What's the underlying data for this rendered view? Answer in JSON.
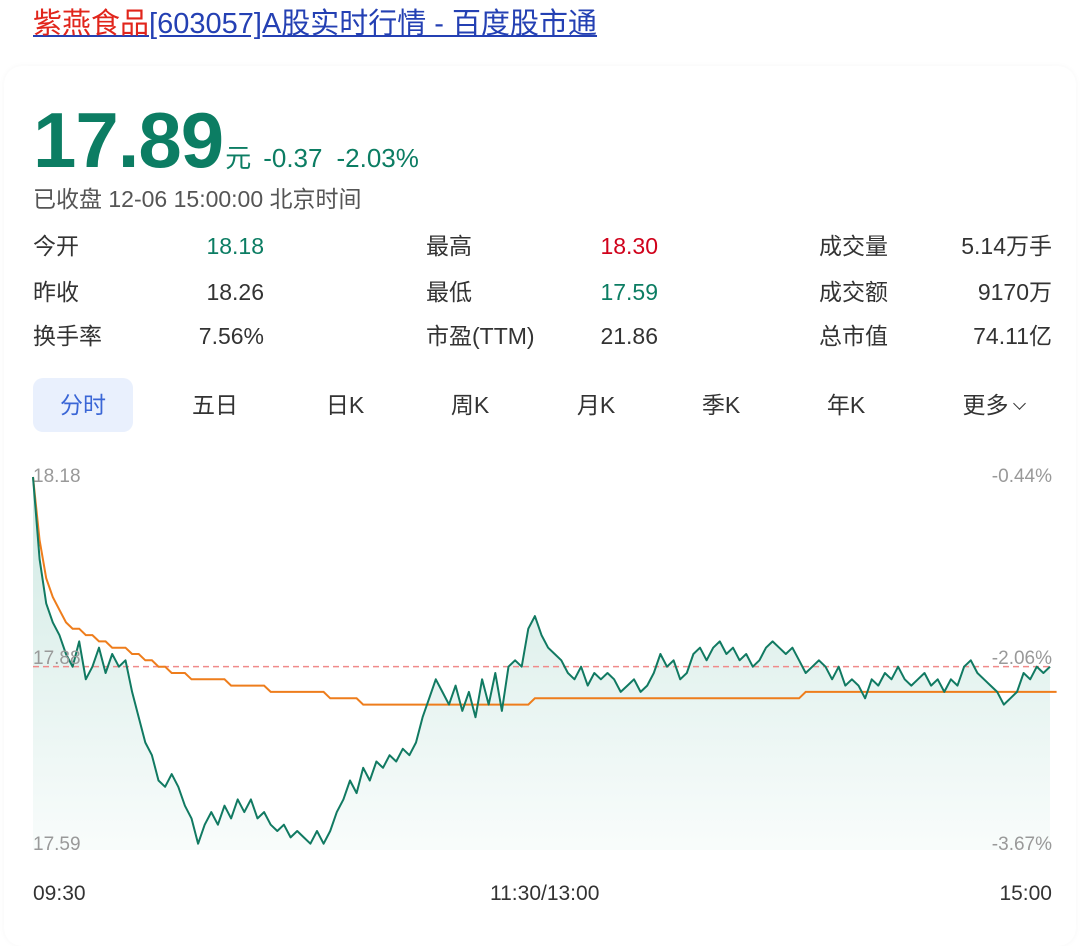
{
  "page": {
    "title_highlight": "紫燕食品",
    "title_rest": "[603057]A股实时行情 - 百度股市通"
  },
  "quote": {
    "price": "17.89",
    "unit": "元",
    "change": "-0.37",
    "change_pct": "-2.03%",
    "status": "已收盘 12-06 15:00:00 北京时间"
  },
  "stats": {
    "open": {
      "label": "今开",
      "value": "18.18"
    },
    "prev_close": {
      "label": "昨收",
      "value": "18.26"
    },
    "turnover_rate": {
      "label": "换手率",
      "value": "7.56%"
    },
    "high": {
      "label": "最高",
      "value": "18.30"
    },
    "low": {
      "label": "最低",
      "value": "17.59"
    },
    "pe": {
      "label": "市盈(TTM)",
      "value": "21.86"
    },
    "volume": {
      "label": "成交量",
      "value": "5.14万手"
    },
    "amount": {
      "label": "成交额",
      "value": "9170万"
    },
    "market_cap": {
      "label": "总市值",
      "value": "74.11亿"
    }
  },
  "tabs": [
    {
      "label": "分时",
      "active": true
    },
    {
      "label": "五日"
    },
    {
      "label": "日K"
    },
    {
      "label": "周K"
    },
    {
      "label": "月K"
    },
    {
      "label": "季K"
    },
    {
      "label": "年K"
    },
    {
      "label": "更多"
    }
  ],
  "colors": {
    "down": "#0c7d63",
    "up": "#d0021b",
    "avg_line": "#ee7d1c",
    "ref_line": "#f08a8a"
  },
  "chart_data": {
    "type": "line",
    "y_left_labels": [
      "18.18",
      "17.88",
      "17.59"
    ],
    "y_right_labels": [
      "-0.44%",
      "-2.06%",
      "-3.67%"
    ],
    "x_labels": [
      "09:30",
      "11:30/13:00",
      "15:00"
    ],
    "ylim": [
      17.59,
      18.18
    ],
    "reference_price": 17.88,
    "series": [
      {
        "role": "price",
        "values": [
          18.18,
          18.05,
          17.98,
          17.95,
          17.93,
          17.9,
          17.88,
          17.92,
          17.86,
          17.88,
          17.91,
          17.87,
          17.9,
          17.88,
          17.89,
          17.84,
          17.8,
          17.76,
          17.74,
          17.7,
          17.69,
          17.71,
          17.69,
          17.66,
          17.64,
          17.6,
          17.63,
          17.65,
          17.63,
          17.66,
          17.64,
          17.67,
          17.65,
          17.67,
          17.64,
          17.65,
          17.63,
          17.62,
          17.63,
          17.61,
          17.62,
          17.61,
          17.6,
          17.62,
          17.6,
          17.62,
          17.65,
          17.67,
          17.7,
          17.68,
          17.72,
          17.7,
          17.73,
          17.72,
          17.74,
          17.73,
          17.75,
          17.74,
          17.76,
          17.8,
          17.83,
          17.86,
          17.84,
          17.82,
          17.85,
          17.81,
          17.84,
          17.8,
          17.86,
          17.82,
          17.87,
          17.81,
          17.88,
          17.89,
          17.88,
          17.94,
          17.96,
          17.93,
          17.91,
          17.9,
          17.89,
          17.87,
          17.86,
          17.88,
          17.85,
          17.87,
          17.86,
          17.87,
          17.86,
          17.84,
          17.85,
          17.86,
          17.84,
          17.85,
          17.87,
          17.9,
          17.88,
          17.89,
          17.86,
          17.87,
          17.9,
          17.91,
          17.89,
          17.91,
          17.92,
          17.9,
          17.91,
          17.89,
          17.9,
          17.88,
          17.89,
          17.91,
          17.92,
          17.91,
          17.9,
          17.91,
          17.89,
          17.87,
          17.88,
          17.89,
          17.88,
          17.86,
          17.88,
          17.85,
          17.86,
          17.85,
          17.83,
          17.86,
          17.85,
          17.87,
          17.86,
          17.88,
          17.86,
          17.85,
          17.86,
          17.87,
          17.85,
          17.86,
          17.84,
          17.86,
          17.85,
          17.88,
          17.89,
          17.87,
          17.86,
          17.85,
          17.84,
          17.82,
          17.83,
          17.84,
          17.87,
          17.86,
          17.88,
          17.87,
          17.88
        ]
      },
      {
        "role": "average",
        "values": [
          18.18,
          18.08,
          18.02,
          17.99,
          17.97,
          17.95,
          17.94,
          17.94,
          17.93,
          17.93,
          17.92,
          17.92,
          17.91,
          17.91,
          17.91,
          17.9,
          17.9,
          17.89,
          17.89,
          17.88,
          17.88,
          17.87,
          17.87,
          17.87,
          17.86,
          17.86,
          17.86,
          17.86,
          17.86,
          17.86,
          17.85,
          17.85,
          17.85,
          17.85,
          17.85,
          17.85,
          17.84,
          17.84,
          17.84,
          17.84,
          17.84,
          17.84,
          17.84,
          17.84,
          17.84,
          17.83,
          17.83,
          17.83,
          17.83,
          17.83,
          17.82,
          17.82,
          17.82,
          17.82,
          17.82,
          17.82,
          17.82,
          17.82,
          17.82,
          17.82,
          17.82,
          17.82,
          17.82,
          17.82,
          17.82,
          17.82,
          17.82,
          17.82,
          17.82,
          17.82,
          17.82,
          17.82,
          17.82,
          17.82,
          17.82,
          17.82,
          17.83,
          17.83,
          17.83,
          17.83,
          17.83,
          17.83,
          17.83,
          17.83,
          17.83,
          17.83,
          17.83,
          17.83,
          17.83,
          17.83,
          17.83,
          17.83,
          17.83,
          17.83,
          17.83,
          17.83,
          17.83,
          17.83,
          17.83,
          17.83,
          17.83,
          17.83,
          17.83,
          17.83,
          17.83,
          17.83,
          17.83,
          17.83,
          17.83,
          17.83,
          17.83,
          17.83,
          17.83,
          17.83,
          17.83,
          17.83,
          17.83,
          17.84,
          17.84,
          17.84,
          17.84,
          17.84,
          17.84,
          17.84,
          17.84,
          17.84,
          17.84,
          17.84,
          17.84,
          17.84,
          17.84,
          17.84,
          17.84,
          17.84,
          17.84,
          17.84,
          17.84,
          17.84,
          17.84,
          17.84,
          17.84,
          17.84,
          17.84,
          17.84,
          17.84,
          17.84,
          17.84,
          17.84,
          17.84,
          17.84,
          17.84,
          17.84,
          17.84,
          17.84,
          17.84,
          17.84
        ]
      }
    ]
  }
}
